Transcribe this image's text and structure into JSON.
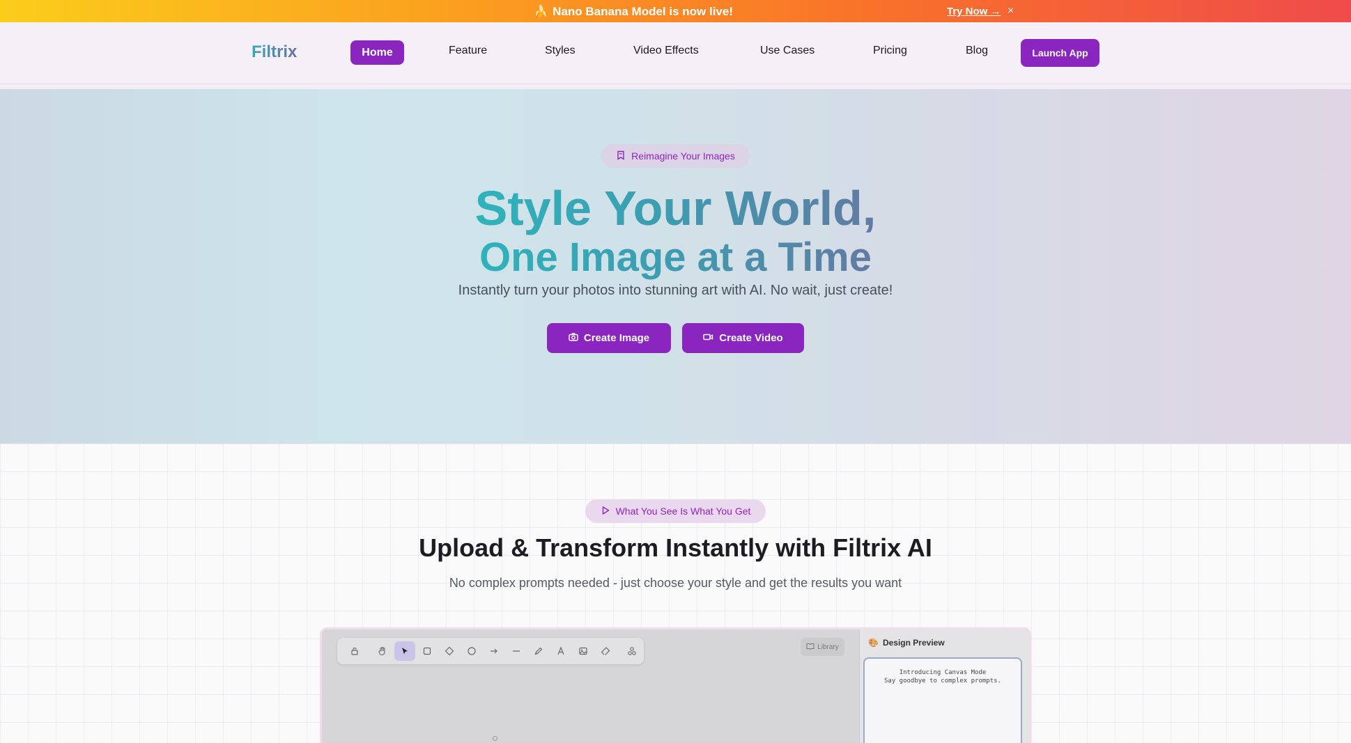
{
  "announcement": {
    "icon": "banana-icon",
    "message": "Nano Banana Model is now live!",
    "cta": "Try Now →",
    "close": "×"
  },
  "nav": {
    "logo": "Filtrix",
    "items": [
      "Home",
      "Feature",
      "Styles",
      "Video Effects",
      "Use Cases",
      "Pricing",
      "Blog"
    ],
    "active": "Home",
    "launch": "Launch App"
  },
  "hero": {
    "badge": "Reimagine Your Images",
    "title_line1": "Style Your World,",
    "title_line2": "One Image at a Time",
    "subtitle": "Instantly turn your photos into stunning art with AI. No wait, just create!",
    "cta_image": "Create Image",
    "cta_video": "Create Video"
  },
  "section": {
    "badge": "What You See Is What You Get",
    "title": "Upload & Transform Instantly with Filtrix AI",
    "subtitle": "No complex prompts needed - just choose your style and get the results you want"
  },
  "canvas": {
    "tools": [
      "lock-icon",
      "hand-icon",
      "pointer-icon",
      "rectangle-icon",
      "diamond-icon",
      "circle-icon",
      "arrow-icon",
      "line-icon",
      "pencil-icon",
      "text-icon",
      "image-icon",
      "eraser-icon",
      "shapes-icon"
    ],
    "active_tool": "pointer-icon",
    "library": "Library",
    "preview_title": "Design Preview",
    "preview_line1": "Introducing Canvas Mode",
    "preview_line2": "Say goodbye to complex prompts."
  },
  "colors": {
    "accent": "#8a25bf",
    "gradient_start": "#2fb3bb",
    "gradient_end": "#637aa2"
  }
}
